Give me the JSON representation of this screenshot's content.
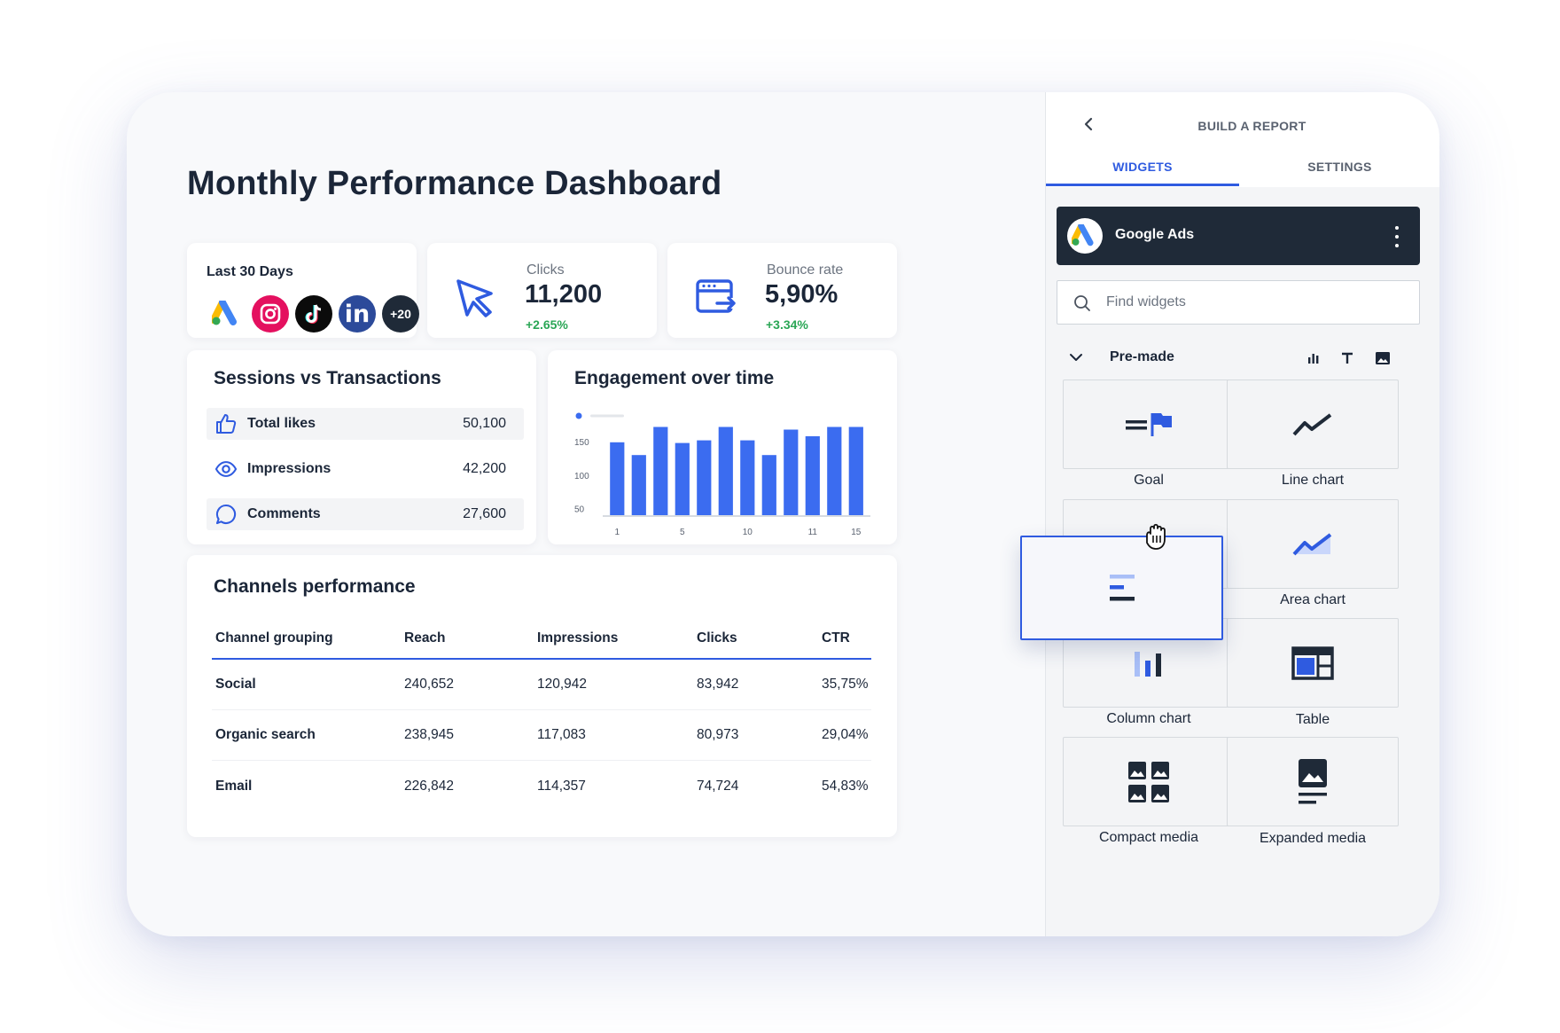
{
  "dashboard": {
    "title": "Monthly Performance Dashboard",
    "sources_card": {
      "label": "Last 30 Days",
      "icons": [
        "google-ads-icon",
        "instagram-icon",
        "tiktok-icon",
        "linkedin-icon"
      ],
      "linkedin_glyph": "in",
      "more_label": "+20"
    },
    "clicks": {
      "label": "Clicks",
      "value": "11,200",
      "delta": "+2.65%",
      "icon": "cursor-icon"
    },
    "bounce": {
      "label": "Bounce rate",
      "value": "5,90%",
      "delta": "+3.34%",
      "icon": "browser-exit-icon"
    },
    "sessions": {
      "title": "Sessions vs Transactions",
      "rows": [
        {
          "label": "Total likes",
          "value": "50,100",
          "icon": "thumbs-up-icon"
        },
        {
          "label": "Impressions",
          "value": "42,200",
          "icon": "eye-icon"
        },
        {
          "label": "Comments",
          "value": "27,600",
          "icon": "comment-icon"
        }
      ]
    },
    "engagement": {
      "title": "Engagement over time"
    },
    "channels": {
      "title": "Channels performance",
      "columns": [
        "Channel grouping",
        "Reach",
        "Impressions",
        "Clicks",
        "CTR"
      ],
      "rows": [
        [
          "Social",
          "240,652",
          "120,942",
          "83,942",
          "35,75%"
        ],
        [
          "Organic search",
          "238,945",
          "117,083",
          "80,973",
          "29,04%"
        ],
        [
          "Email",
          "226,842",
          "114,357",
          "74,724",
          "54,83%"
        ]
      ]
    }
  },
  "chart_data": {
    "type": "bar",
    "title": "Engagement over time",
    "xlabel": "",
    "ylabel": "",
    "y_ticks": [
      50,
      100,
      150
    ],
    "x_ticks": [
      "1",
      "5",
      "10",
      "11",
      "15"
    ],
    "ylim": [
      40,
      170
    ],
    "categories": [
      "1",
      "",
      "",
      "5",
      "",
      "",
      "10",
      "",
      "",
      "11",
      "",
      "15"
    ],
    "values": [
      149,
      130,
      172,
      148,
      152,
      172,
      152,
      130,
      168,
      158,
      172,
      172
    ],
    "colors": {
      "bar": "#3b6cf0",
      "axis": "#d7dbe1"
    },
    "grid": false,
    "legend": "top-left"
  },
  "panel": {
    "title": "BUILD A REPORT",
    "tabs": [
      "WIDGETS",
      "SETTINGS"
    ],
    "active_tab": "WIDGETS",
    "source": {
      "name": "Google Ads",
      "icon": "google-ads-icon"
    },
    "search": {
      "placeholder": "Find widgets",
      "value": ""
    },
    "section": {
      "label": "Pre-made",
      "filters": [
        "chart-filter-icon",
        "text-filter-icon",
        "image-filter-icon"
      ]
    },
    "widgets": [
      {
        "label": "Goal",
        "icon": "goal-flag-icon"
      },
      {
        "label": "Line chart",
        "icon": "line-chart-icon"
      },
      {
        "label": "",
        "icon": "bar-widget-icon"
      },
      {
        "label": "Area chart",
        "icon": "area-chart-icon"
      },
      {
        "label": "Column chart",
        "icon": "column-chart-icon"
      },
      {
        "label": "Table",
        "icon": "table-icon"
      },
      {
        "label": "Compact media",
        "icon": "compact-media-icon"
      },
      {
        "label": "Expanded media",
        "icon": "expanded-media-icon"
      }
    ]
  },
  "colors": {
    "accent": "#2f5be0",
    "positive": "#2aa655",
    "dark": "#1f2a38"
  }
}
